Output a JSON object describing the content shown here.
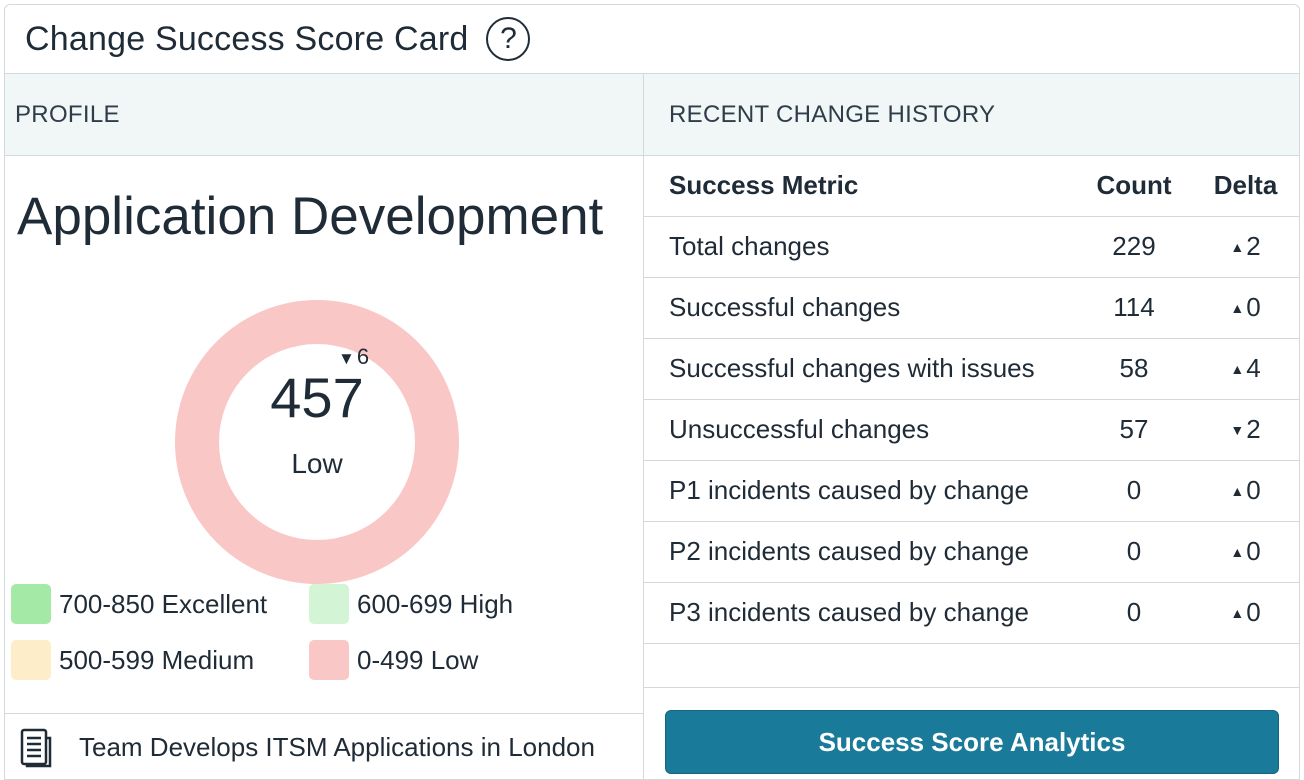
{
  "header": {
    "title": "Change Success Score Card",
    "help_icon": "question-circle-icon"
  },
  "profile": {
    "section_label": "PROFILE",
    "name": "Application Development",
    "score": {
      "value": "457",
      "delta": "6",
      "delta_direction": "down",
      "rating": "Low",
      "ring_color": "#f9c7c5"
    },
    "legend": [
      {
        "label": "700-850 Excellent",
        "color": "#a5e9a6"
      },
      {
        "label": "600-699 High",
        "color": "#d4f4d6"
      },
      {
        "label": "500-599 Medium",
        "color": "#fdedc8"
      },
      {
        "label": "0-499 Low",
        "color": "#f9c7c5"
      }
    ],
    "team_icon": "document-icon",
    "team_text": "Team Develops ITSM Applications in London"
  },
  "history": {
    "section_label": "RECENT CHANGE HISTORY",
    "columns": [
      "Success Metric",
      "Count",
      "Delta"
    ],
    "rows": [
      {
        "metric": "Total changes",
        "count": "229",
        "delta": "2",
        "dir": "up"
      },
      {
        "metric": "Successful changes",
        "count": "114",
        "delta": "0",
        "dir": "up"
      },
      {
        "metric": "Successful changes with issues",
        "count": "58",
        "delta": "4",
        "dir": "up"
      },
      {
        "metric": "Unsuccessful changes",
        "count": "57",
        "delta": "2",
        "dir": "down"
      },
      {
        "metric": "P1 incidents caused by change",
        "count": "0",
        "delta": "0",
        "dir": "up"
      },
      {
        "metric": "P2 incidents caused by change",
        "count": "0",
        "delta": "0",
        "dir": "up"
      },
      {
        "metric": "P3 incidents caused by change",
        "count": "0",
        "delta": "0",
        "dir": "up"
      }
    ],
    "button_label": "Success Score Analytics",
    "button_color": "#1a7a99"
  }
}
